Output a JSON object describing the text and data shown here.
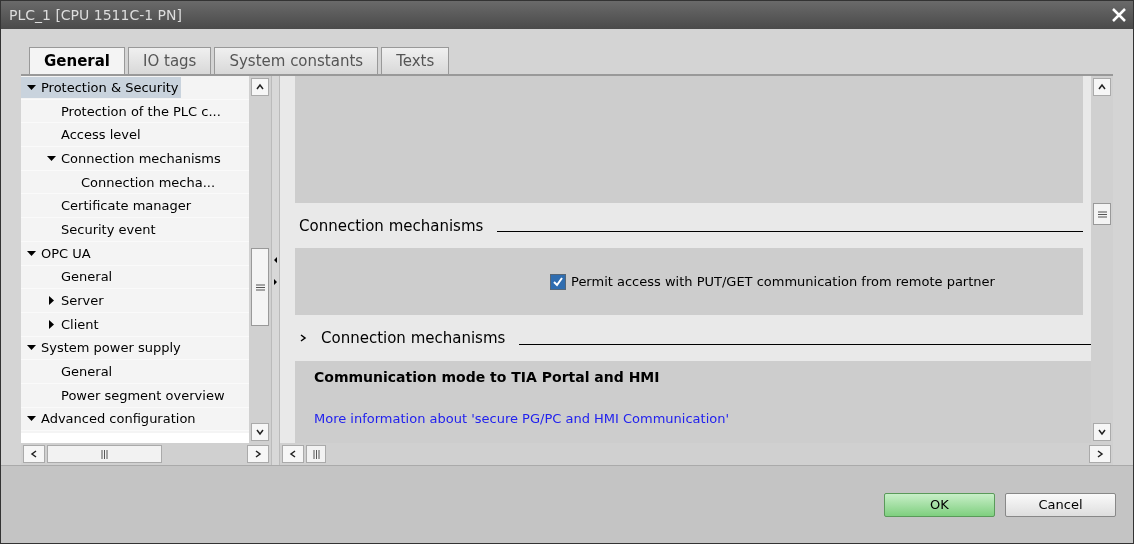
{
  "window": {
    "title": "PLC_1 [CPU 1511C-1 PN]"
  },
  "tabs": [
    {
      "label": "General",
      "selected": true
    },
    {
      "label": "IO tags",
      "selected": false
    },
    {
      "label": "System constants",
      "selected": false
    },
    {
      "label": "Texts",
      "selected": false
    }
  ],
  "tree": [
    {
      "label": "Protection & Security",
      "selected": true,
      "expanded": true,
      "children": [
        {
          "label": "Protection of the PLC c...",
          "selected": false
        },
        {
          "label": "Access level",
          "selected": false
        },
        {
          "label": "Connection mechanisms",
          "selected": false,
          "expanded": true,
          "children": [
            {
              "label": "Connection mecha...",
              "selected": false
            }
          ]
        },
        {
          "label": "Certificate manager",
          "selected": false
        },
        {
          "label": "Security event",
          "selected": false
        }
      ]
    },
    {
      "label": "OPC UA",
      "selected": false,
      "expanded": true,
      "children": [
        {
          "label": "General",
          "selected": false
        },
        {
          "label": "Server",
          "selected": false,
          "expanded": false
        },
        {
          "label": "Client",
          "selected": false,
          "expanded": false
        }
      ]
    },
    {
      "label": "System power supply",
      "selected": false,
      "expanded": true,
      "children": [
        {
          "label": "General",
          "selected": false
        },
        {
          "label": "Power segment overview",
          "selected": false
        }
      ]
    },
    {
      "label": "Advanced configuration",
      "selected": false,
      "expanded": true
    }
  ],
  "content": {
    "section_title": "Connection mechanisms",
    "checkbox": {
      "label": "Permit access with PUT/GET communication from remote partner",
      "checked": true
    },
    "subsection": {
      "title": "Connection mechanisms",
      "expanded": false
    },
    "heading": "Communication mode to TIA Portal and HMI",
    "link": "More information about 'secure PG/PC and HMI Communication'"
  },
  "buttons": [
    {
      "label": "OK",
      "kind": "primary"
    },
    {
      "label": "Cancel",
      "kind": "secondary"
    }
  ]
}
